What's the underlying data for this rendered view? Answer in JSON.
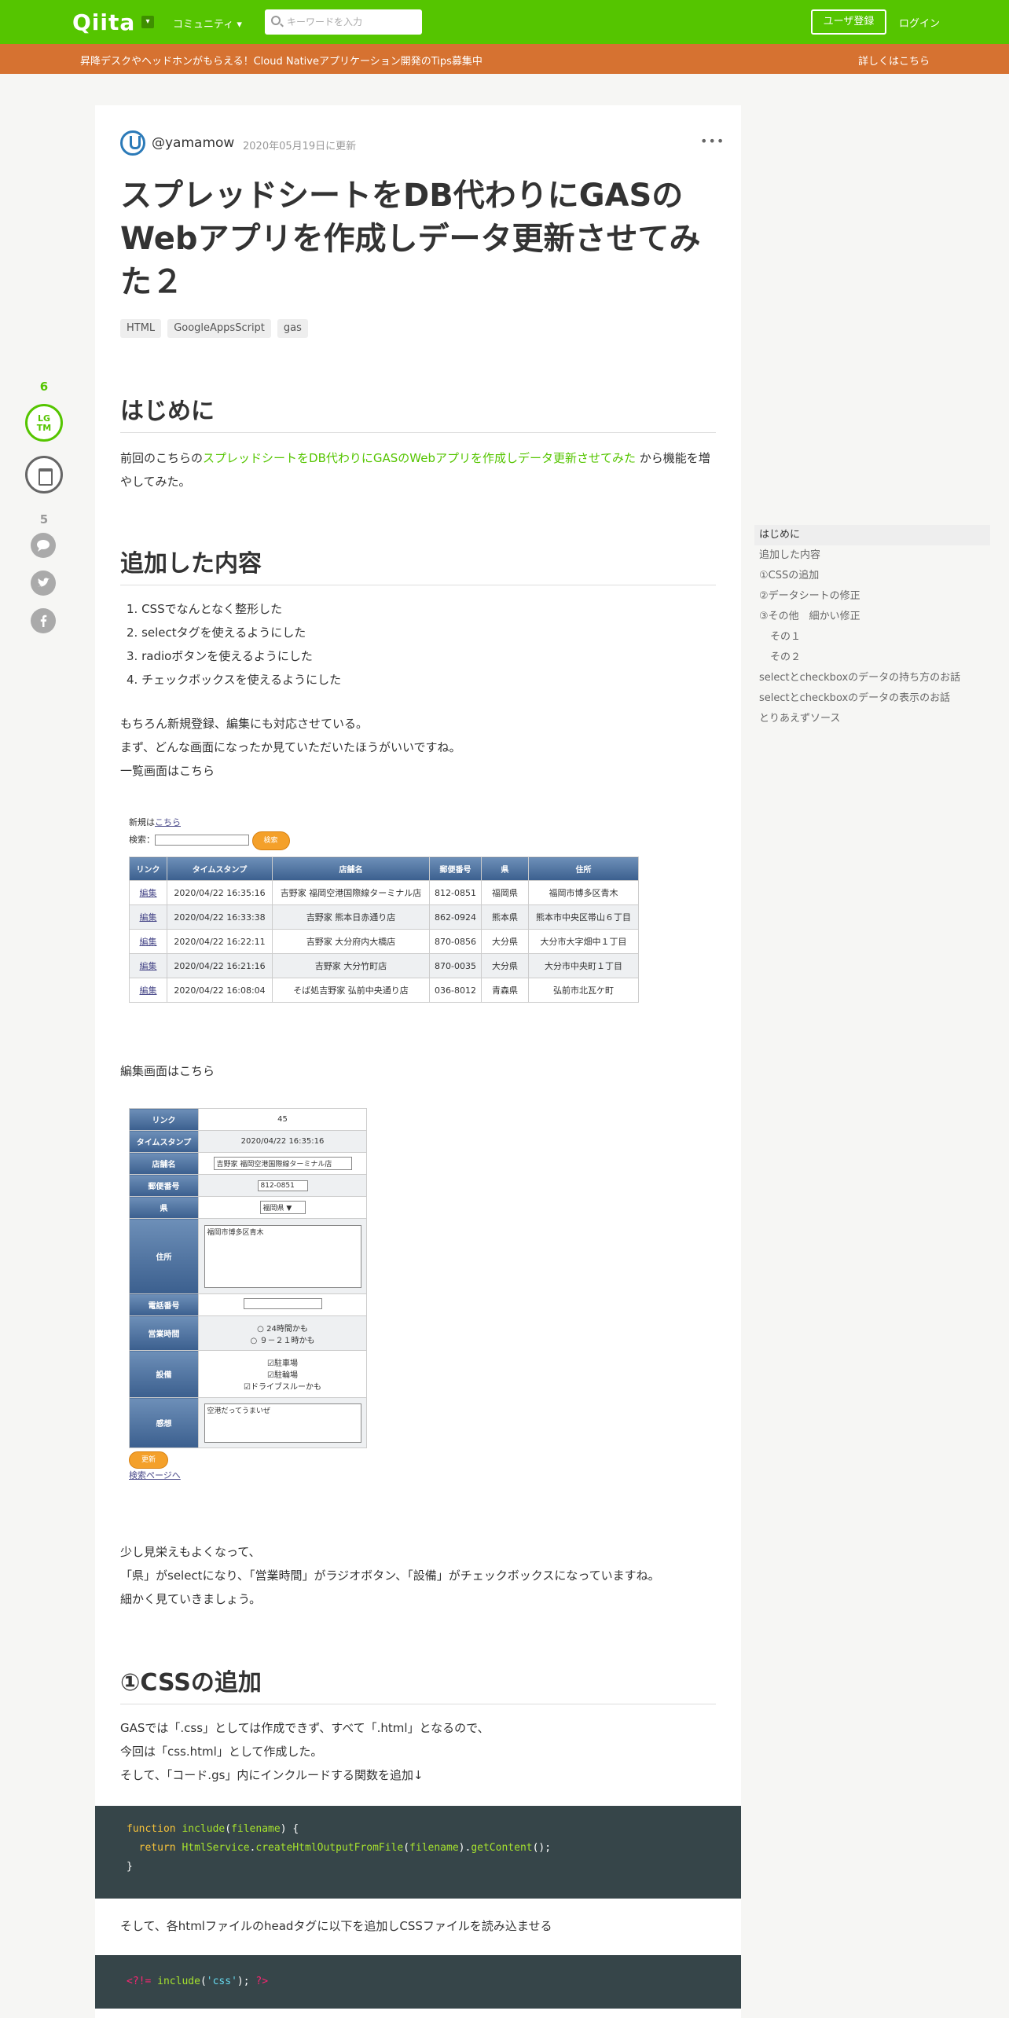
{
  "header": {
    "logo": "Qiita",
    "community_label": "コミュニティ",
    "search_placeholder": "キーワードを入力",
    "signup_label": "ユーザ登録",
    "login_label": "ログイン"
  },
  "banner": {
    "text": "昇降デスクやヘッドホンがもらえる！Cloud Nativeアプリケーション開発のTips募集中",
    "link": "詳しくはこちら"
  },
  "sidebar": {
    "lgtm_count": "6",
    "lgtm_label_1": "LG",
    "lgtm_label_2": "TM",
    "comment_count": "5"
  },
  "article": {
    "author": "@yamamow",
    "updated": "2020年05月19日に更新",
    "more": "•••",
    "title": "スプレッドシートをDB代わりにGASのWebアプリを作成しデータ更新させてみた２",
    "tags": [
      "HTML",
      "GoogleAppsScript",
      "gas"
    ],
    "sections": {
      "intro_heading": "はじめに",
      "intro_p_prefix": "前回のこちらの",
      "intro_link": "スプレッドシートをDB代わりにGASのWebアプリを作成しデータ更新させてみた",
      "intro_p_suffix": " から機能を増やしてみた。",
      "added_heading": "追加した内容",
      "added_items": [
        "1. CSSでなんとなく整形した",
        "2. selectタグを使えるようにした",
        "3. radioボタンを使えるようにした",
        "4. チェックボックスを使えるようにした"
      ],
      "added_p1": "もちろん新規登録、編集にも対応させている。",
      "added_p2": "まず、どんな画面になったか見ていただいたほうがいいですね。",
      "added_p3": "一覧画面はこちら",
      "edit_p": "編集画面はこちら",
      "after_p1": "少し見栄えもよくなって、",
      "after_p2": "「県」がselectになり、「営業時間」がラジオボタン、「設備」がチェックボックスになっていますね。",
      "after_p3": "細かく見ていきましょう。",
      "css_heading": "①CSSの追加",
      "css_p1": "GASでは「.css」としては作成できず、すべて「.html」となるので、",
      "css_p2": "今回は「css.html」として作成した。",
      "css_p3": "そして、「コード.gs」内にインクルードする関数を追加↓",
      "code1_l1_kw": "function",
      "code1_l1_fn": "include",
      "code1_l1_arg": "filename",
      "code1_l2_kw": "return",
      "code1_l2_obj": "HtmlService",
      "code1_l2_method": "createHtmlOutputFromFile",
      "code1_l2_arg": "filename",
      "code1_l2_get": "getContent",
      "code1_l3": "}",
      "css_p4": "そして、各htmlファイルのheadタグに以下を追加しCSSファイルを読み込ませる",
      "code2_open": "<?!=",
      "code2_fn": "include",
      "code2_str": "'css'",
      "code2_close": "?>"
    }
  },
  "list_screen": {
    "new_label": "新規は",
    "new_link": "こちら",
    "search_label": "検索：",
    "search_button": "検索",
    "headers": [
      "リンク",
      "タイムスタンプ",
      "店舗名",
      "郵便番号",
      "県",
      "住所"
    ],
    "rows": [
      [
        "編集",
        "2020/04/22 16:35:16",
        "吉野家 福岡空港国際線ターミナル店",
        "812-0851",
        "福岡県",
        "福岡市博多区青木"
      ],
      [
        "編集",
        "2020/04/22 16:33:38",
        "吉野家 熊本日赤通り店",
        "862-0924",
        "熊本県",
        "熊本市中央区帯山６丁目"
      ],
      [
        "編集",
        "2020/04/22 16:22:11",
        "吉野家 大分府内大橋店",
        "870-0856",
        "大分県",
        "大分市大字畑中１丁目"
      ],
      [
        "編集",
        "2020/04/22 16:21:16",
        "吉野家 大分竹町店",
        "870-0035",
        "大分県",
        "大分市中央町１丁目"
      ],
      [
        "編集",
        "2020/04/22 16:08:04",
        "そば処吉野家 弘前中央通り店",
        "036-8012",
        "青森県",
        "弘前市北瓦ケ町"
      ]
    ]
  },
  "edit_screen": {
    "labels": [
      "リンク",
      "タイムスタンプ",
      "店舗名",
      "郵便番号",
      "県",
      "住所",
      "電話番号",
      "営業時間",
      "設備",
      "感想"
    ],
    "link_value": "45",
    "timestamp_value": "2020/04/22 16:35:16",
    "store_value": "吉野家 福岡空港国際線ターミナル店",
    "zip_value": "812-0851",
    "pref_value": "福岡県",
    "address_value": "福岡市博多区青木",
    "hours_1": "24時間かも",
    "hours_2": "９－２１時かも",
    "facility_1": "駐車場",
    "facility_2": "駐輪場",
    "facility_3": "ドライブスルーかも",
    "impression_value": "空港だってうまいぜ",
    "update_button": "更新",
    "search_page_link": "検索ページへ"
  },
  "toc": [
    "はじめに",
    "追加した内容",
    "①CSSの追加",
    "②データシートの修正",
    "③その他　細かい修正",
    "その１",
    "その２",
    "selectとcheckboxのデータの持ち方のお話",
    "selectとcheckboxのデータの表示のお話",
    "とりあえずソース"
  ]
}
